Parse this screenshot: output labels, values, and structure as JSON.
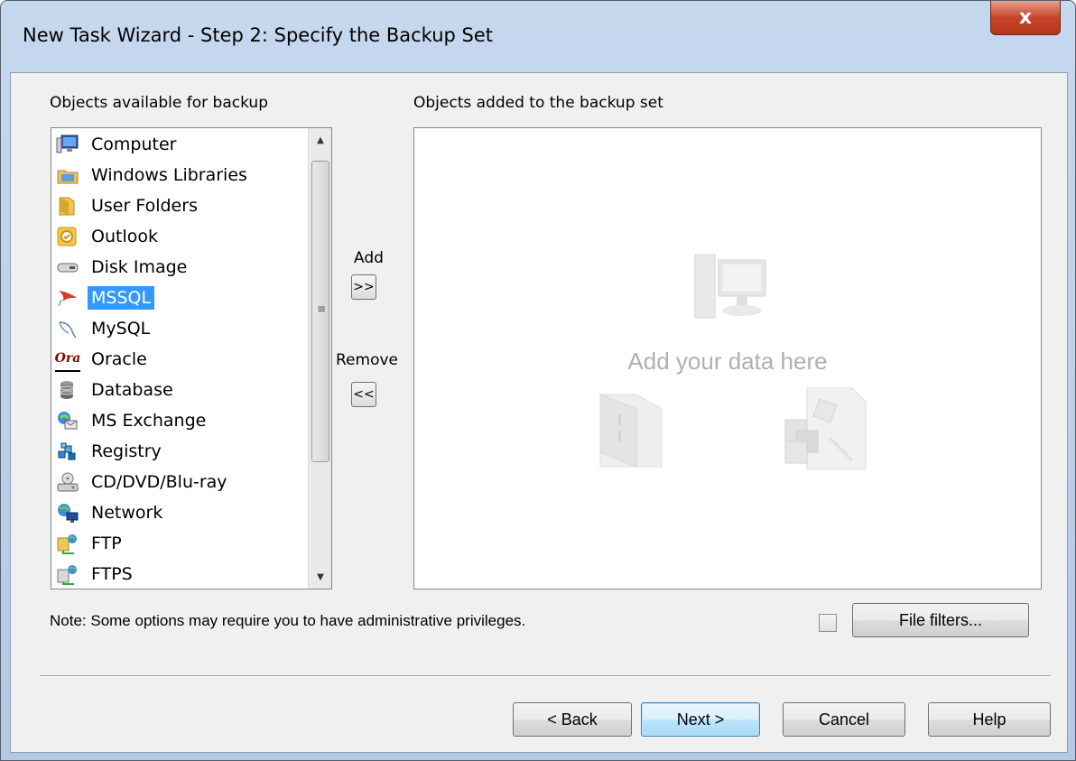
{
  "window": {
    "title": "New Task Wizard - Step 2: Specify the Backup Set",
    "close_label": "x"
  },
  "left_panel": {
    "label": "Objects available for backup",
    "items": [
      {
        "label": "Computer",
        "icon": "computer-icon"
      },
      {
        "label": "Windows Libraries",
        "icon": "library-icon"
      },
      {
        "label": "User Folders",
        "icon": "folder-icon"
      },
      {
        "label": "Outlook",
        "icon": "outlook-icon"
      },
      {
        "label": "Disk Image",
        "icon": "disk-image-icon"
      },
      {
        "label": "MSSQL",
        "icon": "mssql-icon",
        "selected": true
      },
      {
        "label": "MySQL",
        "icon": "mysql-icon"
      },
      {
        "label": "Oracle",
        "icon": "oracle-icon",
        "icon_text": "Ora"
      },
      {
        "label": "Database",
        "icon": "database-icon"
      },
      {
        "label": "MS Exchange",
        "icon": "exchange-icon"
      },
      {
        "label": "Registry",
        "icon": "registry-icon"
      },
      {
        "label": "CD/DVD/Blu-ray",
        "icon": "optical-drive-icon"
      },
      {
        "label": "Network",
        "icon": "network-icon"
      },
      {
        "label": "FTP",
        "icon": "ftp-icon"
      },
      {
        "label": "FTPS",
        "icon": "ftps-icon"
      }
    ]
  },
  "middle": {
    "add_label": "Add",
    "add_button": ">>",
    "remove_label": "Remove",
    "remove_button": "<<"
  },
  "right_panel": {
    "label": "Objects added to the backup set",
    "placeholder": "Add your data here"
  },
  "note": "Note: Some options may require you to have administrative privileges.",
  "file_filters_label": "File filters...",
  "buttons": {
    "back": "< Back",
    "next": "Next >",
    "cancel": "Cancel",
    "help": "Help"
  },
  "colors": {
    "selection": "#3399ff",
    "title_bar": "#c6d8ee",
    "close_button": "#c7452a"
  }
}
